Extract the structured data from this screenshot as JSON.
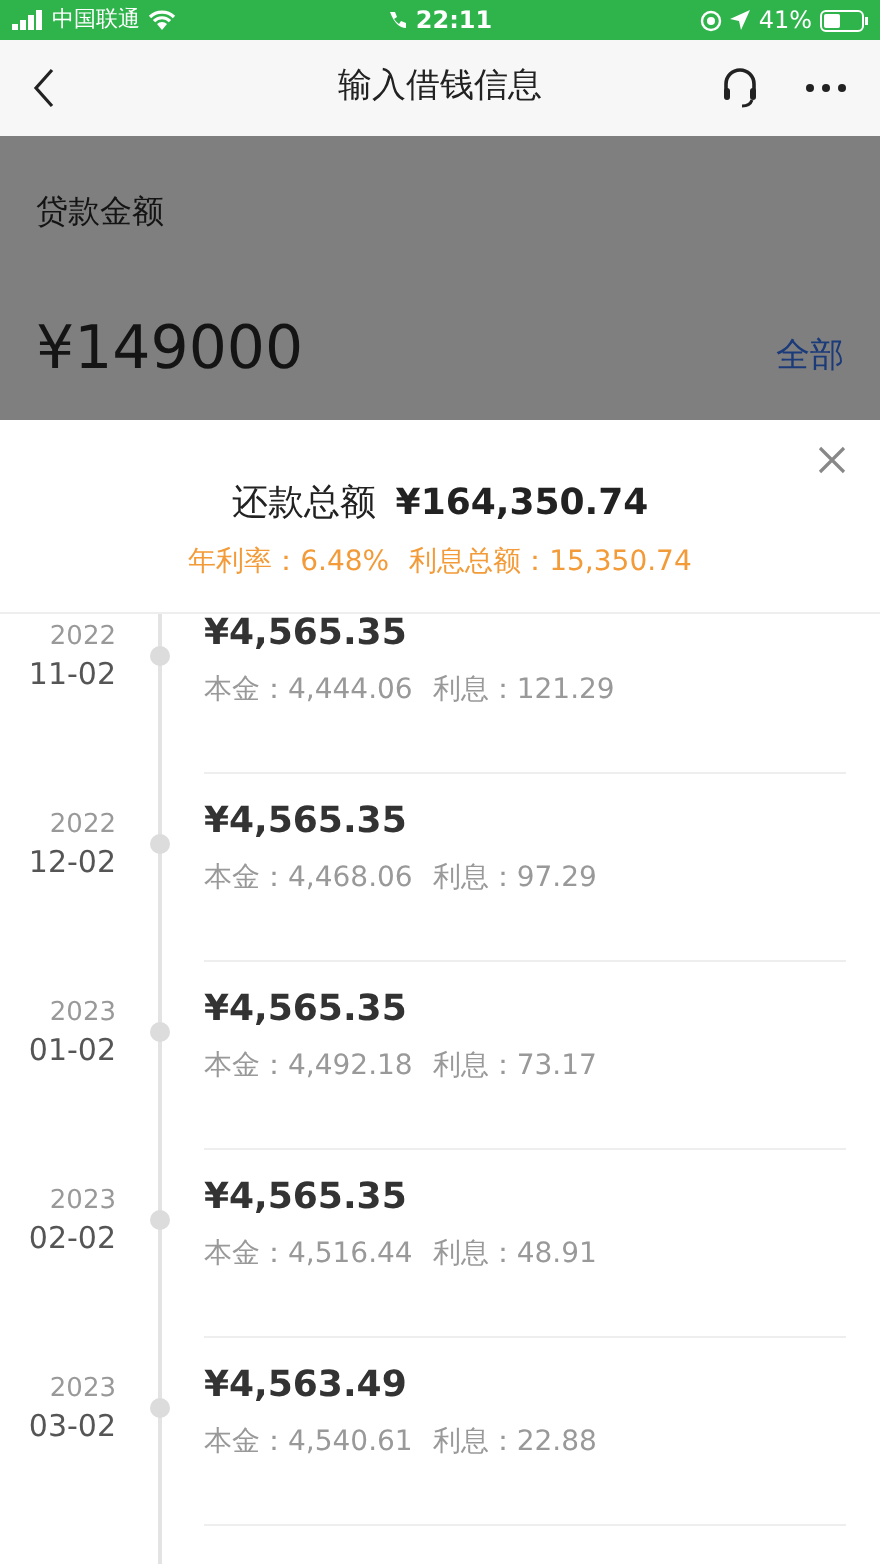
{
  "status_bar": {
    "carrier": "中国联通",
    "time": "22:11",
    "battery": "41%"
  },
  "nav": {
    "title": "输入借钱信息"
  },
  "loan": {
    "label": "贷款金额",
    "amount": "¥149000",
    "all_link": "全部"
  },
  "summary": {
    "total_label": "还款总额",
    "total": "¥164,350.74",
    "rate": "年利率：6.48%",
    "interest_total": "利息总额：15,350.74"
  },
  "schedule": [
    {
      "year": "2022",
      "date": "11-02",
      "amount": "¥4,565.35",
      "principal": "本金：4,444.06",
      "interest": "利息：121.29"
    },
    {
      "year": "2022",
      "date": "12-02",
      "amount": "¥4,565.35",
      "principal": "本金：4,468.06",
      "interest": "利息：97.29"
    },
    {
      "year": "2023",
      "date": "01-02",
      "amount": "¥4,565.35",
      "principal": "本金：4,492.18",
      "interest": "利息：73.17"
    },
    {
      "year": "2023",
      "date": "02-02",
      "amount": "¥4,565.35",
      "principal": "本金：4,516.44",
      "interest": "利息：48.91"
    },
    {
      "year": "2023",
      "date": "03-02",
      "amount": "¥4,563.49",
      "principal": "本金：4,540.61",
      "interest": "利息：22.88"
    }
  ]
}
